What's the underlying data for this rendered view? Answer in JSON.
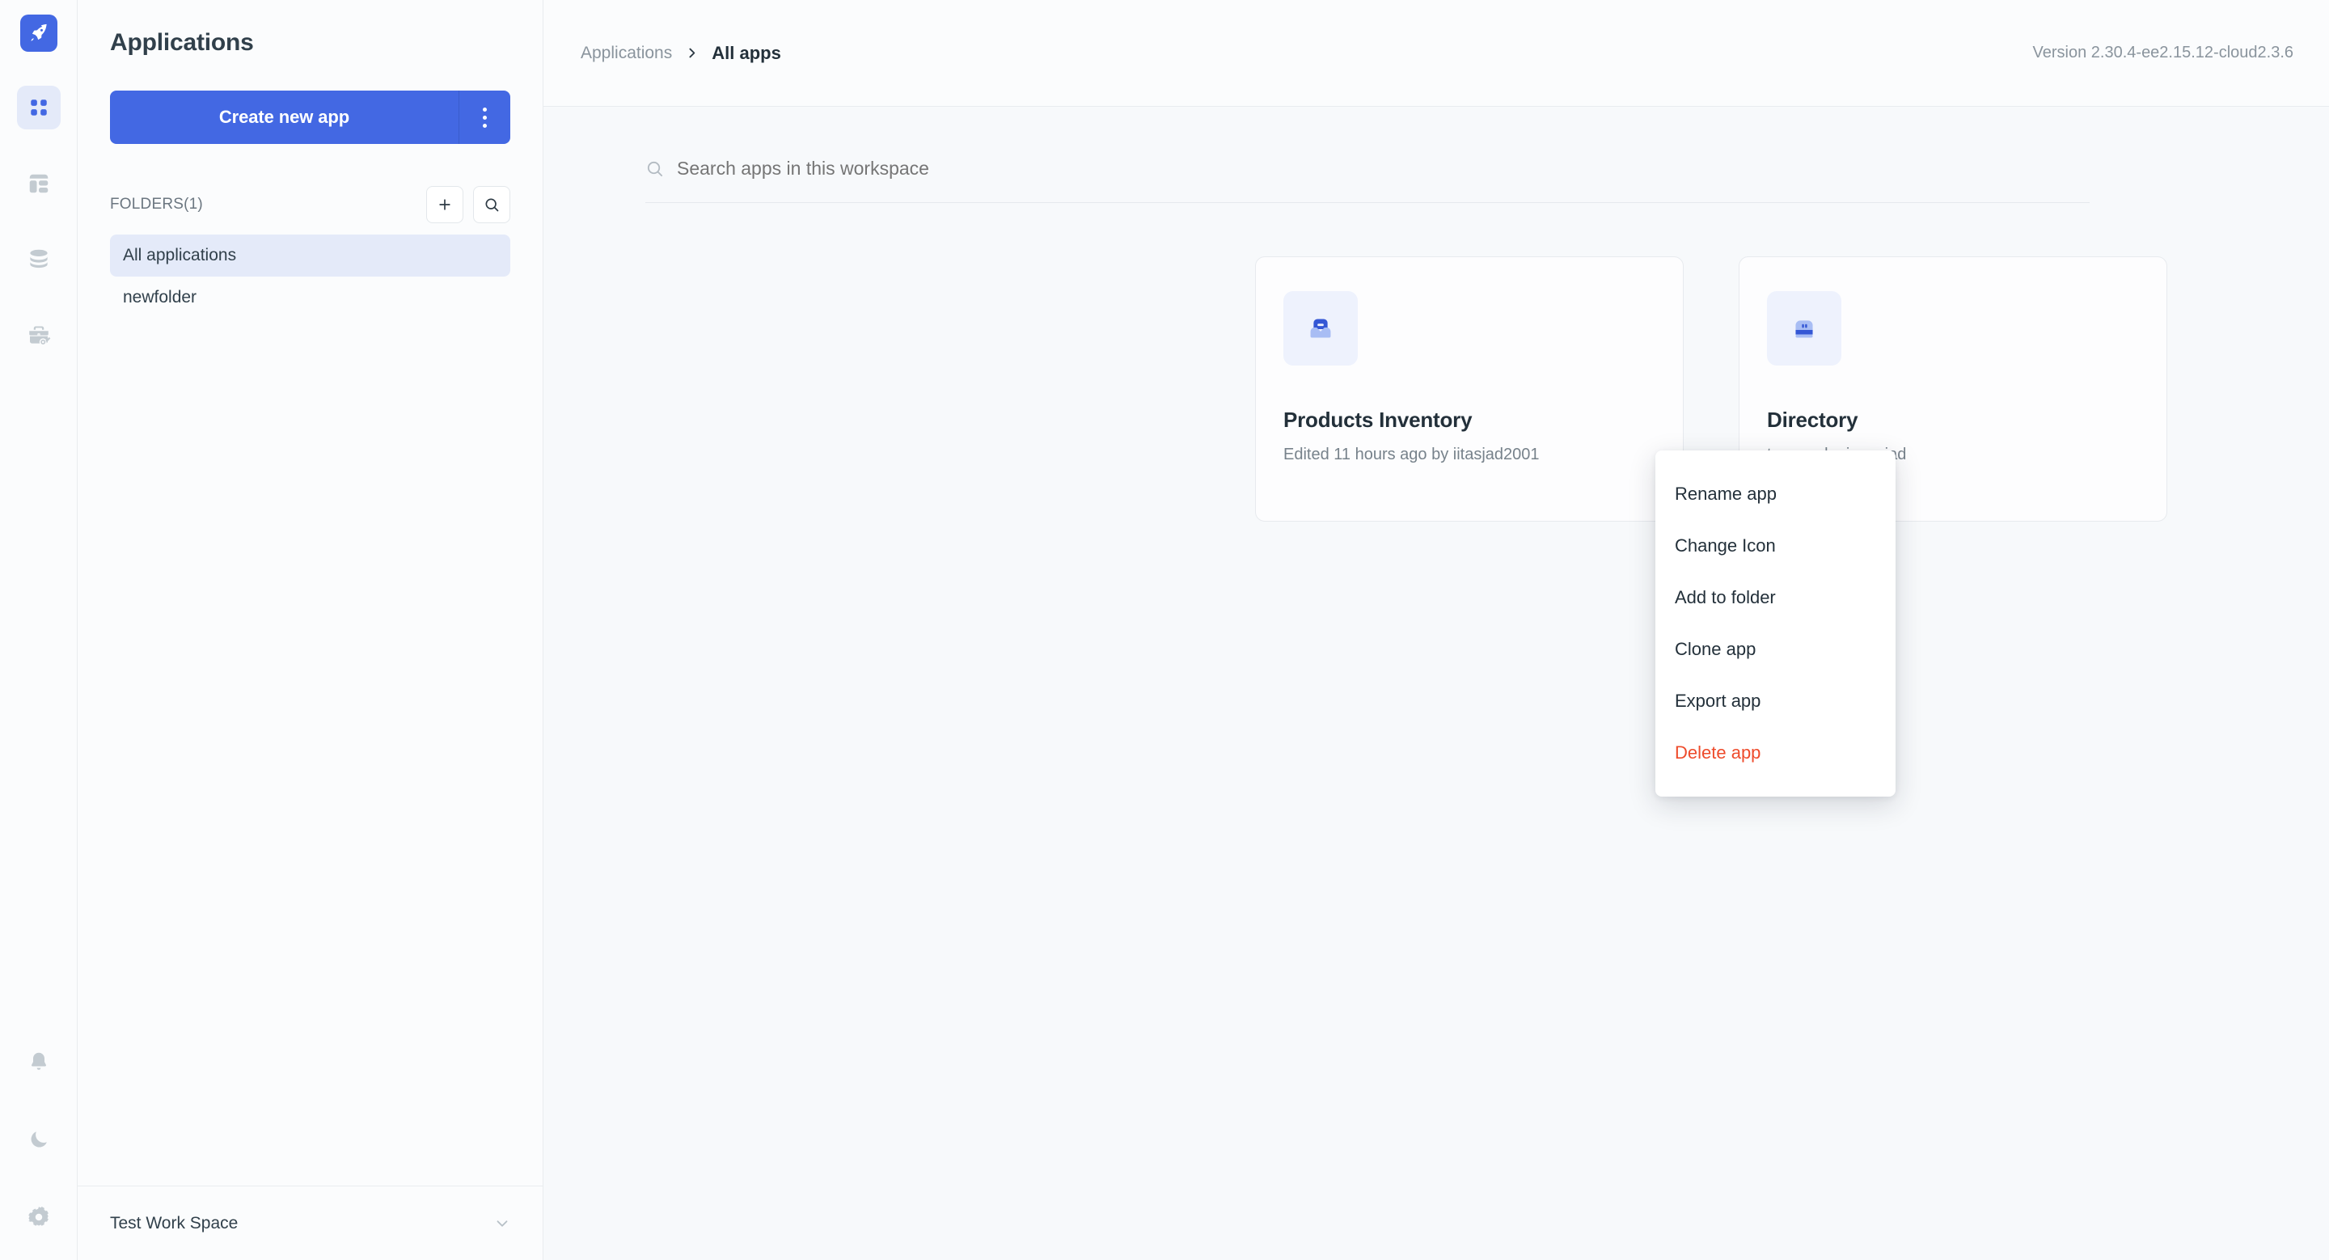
{
  "rail": {
    "logo_icon": "rocket-icon",
    "items": [
      {
        "icon": "grid-apps-icon",
        "name": "apps",
        "active": true
      },
      {
        "icon": "layout-dashboard-icon",
        "name": "workflows",
        "active": false
      },
      {
        "icon": "database-stack-icon",
        "name": "data-sources",
        "active": false
      },
      {
        "icon": "briefcase-key-icon",
        "name": "workspace-constants",
        "active": false
      }
    ],
    "bottom_items": [
      {
        "icon": "bell-icon",
        "name": "notifications"
      },
      {
        "icon": "moon-icon",
        "name": "dark-mode-toggle"
      },
      {
        "icon": "gear-icon",
        "name": "settings"
      }
    ]
  },
  "panel": {
    "title": "Applications",
    "create_label": "Create new app",
    "create_kebab_icon": "kebab-vertical-icon",
    "folders_label": "FOLDERS(1)",
    "add_folder_icon": "plus-icon",
    "search_folder_icon": "search-icon",
    "folders": [
      {
        "label": "All applications",
        "selected": true
      },
      {
        "label": "newfolder",
        "selected": false
      }
    ],
    "workspace": {
      "name": "Test Work Space",
      "chevron_icon": "chevron-down-icon"
    }
  },
  "topbar": {
    "breadcrumb_root": "Applications",
    "breadcrumb_separator_icon": "chevron-right-icon",
    "breadcrumb_current": "All apps",
    "version": "Version 2.30.4-ee2.15.12-cloud2.3.6"
  },
  "search": {
    "icon": "search-icon",
    "placeholder": "Search apps in this workspace",
    "value": ""
  },
  "cards": [
    {
      "name": "Products Inventory",
      "meta": "Edited 11 hours ago by iitasjad2001",
      "icon": "mailbox-icon"
    },
    {
      "name": "Directory",
      "meta": "tes ago by jnuasjad",
      "icon": "robot-icon"
    }
  ],
  "context_menu": {
    "items": [
      {
        "label": "Rename app",
        "danger": false
      },
      {
        "label": "Change Icon",
        "danger": false
      },
      {
        "label": "Add to folder",
        "danger": false
      },
      {
        "label": "Clone app",
        "danger": false
      },
      {
        "label": "Export app",
        "danger": false
      },
      {
        "label": "Delete app",
        "danger": true
      }
    ]
  },
  "colors": {
    "brand": "#4368e3",
    "danger": "#ee4b2b",
    "selected_bg": "#e4eaf9"
  }
}
